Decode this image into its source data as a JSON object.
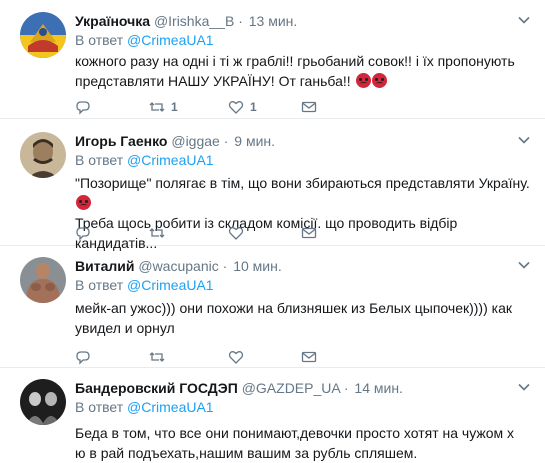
{
  "tweets": [
    {
      "name": "Україночка",
      "handle": "@Irishka__B",
      "time": "13 мин.",
      "reply_prefix": "В ответ ",
      "reply_to": "@CrimeaUA1",
      "text": "кожного разу на одні і ті ж граблі!! грьобаний совок!! і їх пропонують представляти НАШУ УКРАЇНУ! От ганьба!!",
      "retweets": "1",
      "likes": "1",
      "emoji": "angry-face x2"
    },
    {
      "name": "Игорь Гаенко",
      "handle": "@iggae",
      "time": "9 мин.",
      "reply_prefix": "В ответ ",
      "reply_to": "@CrimeaUA1",
      "text": "\"Позорище\" полягає в тім, що вони збираються представляти Україну.",
      "text2": "Треба щось робити із складом комісії. що проводить відбір кандидатів...",
      "emoji": "angry-face"
    },
    {
      "name": "Виталий",
      "handle": "@wacupanic",
      "time": "10 мин.",
      "reply_prefix": "В ответ ",
      "reply_to": "@CrimeaUA1",
      "text": "мейк-ап ужос))) они похожи на близняшек из Белых цыпочек)))) как увидел и орнул"
    },
    {
      "name": "Бандеровский ГОСДЭП",
      "handle": "@GAZDEP_UA",
      "time": "14 мин.",
      "reply_prefix": "В ответ ",
      "reply_to": "@CrimeaUA1",
      "text": "Беда в том, что все они понимают,девочки просто хотят на чужом х  ю в рай подъехать,нашим вашим за рубль спляшем."
    }
  ],
  "separator": "·",
  "colors": {
    "link": "#1da1f2",
    "secondary": "#657786",
    "text": "#14171a",
    "border": "#e6ecf0"
  }
}
